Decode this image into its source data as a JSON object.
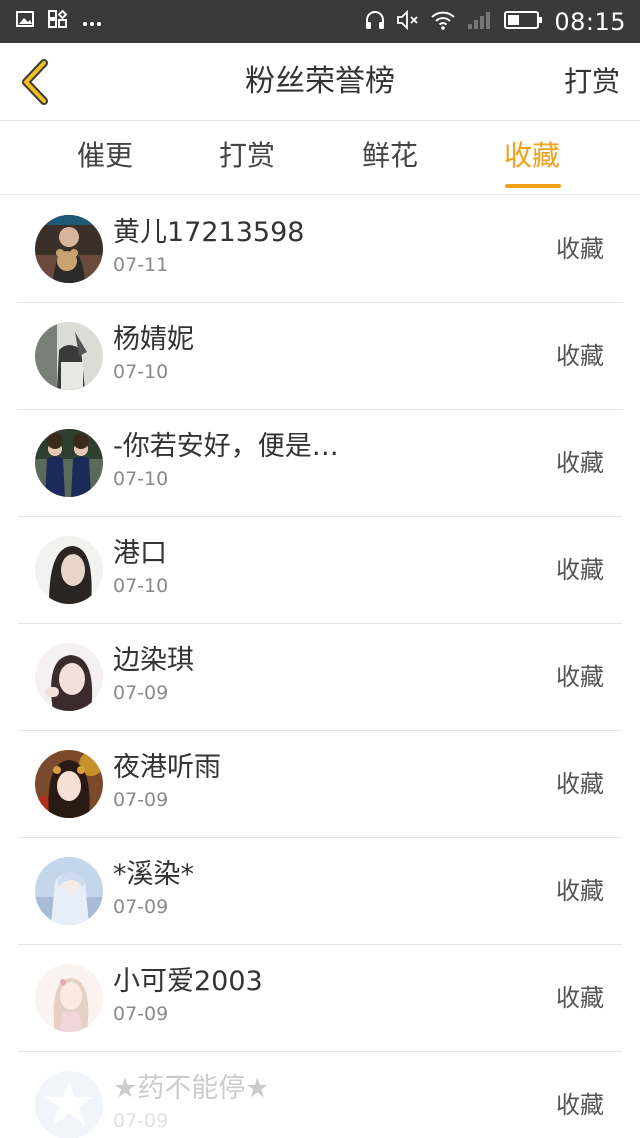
{
  "status_bar": {
    "time": "08:15"
  },
  "header": {
    "title": "粉丝荣誉榜",
    "action": "打赏"
  },
  "tabs": [
    {
      "label": "催更"
    },
    {
      "label": "打赏"
    },
    {
      "label": "鲜花"
    },
    {
      "label": "收藏",
      "active": true
    }
  ],
  "fans": [
    {
      "name": "黄儿17213598",
      "date": "07-11",
      "action": "收藏"
    },
    {
      "name": "杨婧妮",
      "date": "07-10",
      "action": "收藏"
    },
    {
      "name": "-你若安好，便是…",
      "date": "07-10",
      "action": "收藏"
    },
    {
      "name": "港口",
      "date": "07-10",
      "action": "收藏"
    },
    {
      "name": "边染琪",
      "date": "07-09",
      "action": "收藏"
    },
    {
      "name": "夜港听雨",
      "date": "07-09",
      "action": "收藏"
    },
    {
      "name": "*溪染*",
      "date": "07-09",
      "action": "收藏"
    },
    {
      "name": "小可爱2003",
      "date": "07-09",
      "action": "收藏"
    },
    {
      "name": "★药不能停★",
      "date": "07-09",
      "action": "收藏"
    }
  ],
  "colors": {
    "accent": "#f0a019",
    "status_bar_bg": "#3a3a3a"
  }
}
